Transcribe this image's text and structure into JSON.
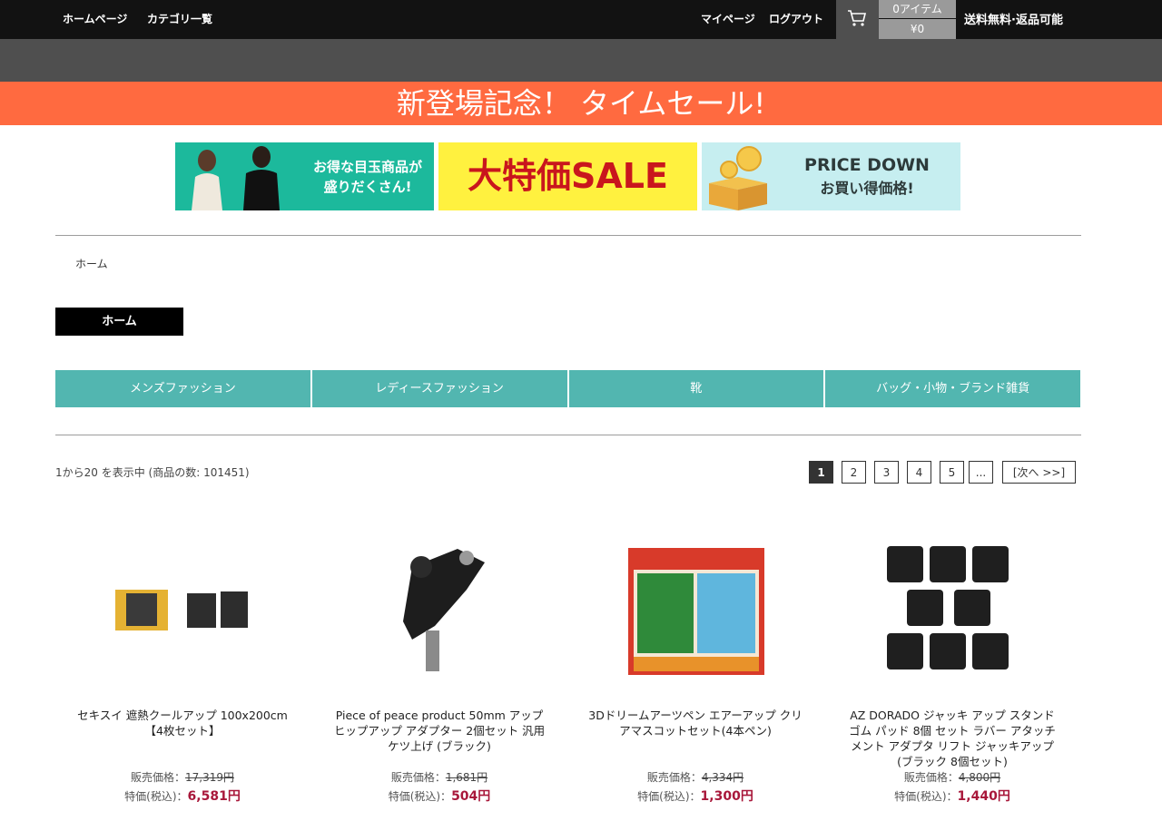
{
  "header": {
    "nav_home": "ホームページ",
    "nav_categories": "カテゴリ一覧",
    "mypage": "マイページ",
    "logout": "ログアウト",
    "cart_icon": "cart-icon",
    "cart_items": "0アイテム",
    "cart_total": "¥0",
    "shipping": "送料無料·返品可能"
  },
  "sale_banner": "新登場記念！ タイムセール!",
  "banners": [
    {
      "line1": "お得な目玉商品が",
      "line2": "盛りだくさん!",
      "bg": "#1cb99c"
    },
    {
      "text": "大特価SALE",
      "bg": "#fff13f",
      "text_color": "#c9161d"
    },
    {
      "line1": "PRICE DOWN",
      "line2": "お買い得価格!",
      "bg": "#c6eef0"
    }
  ],
  "breadcrumb": "ホーム",
  "page_title": "ホーム",
  "categories": [
    "メンズファッション",
    "レディースファッション",
    "靴",
    "バッグ・小物・ブランド雑貨"
  ],
  "results_text": "1から20 を表示中 (商品の数: 101451)",
  "pagination": [
    "1",
    "2",
    "3",
    "4",
    "5",
    "...",
    "[次へ >>]"
  ],
  "products": [
    {
      "name": "セキスイ 遮熱クールアップ 100x200cm【4枚セット】",
      "list_label": "販売価格：",
      "list_price": "17,319円",
      "sale_label": "特価(税込)：",
      "sale_price": "6,581円"
    },
    {
      "name": "Piece of peace product 50mm アップ ヒップアップ アダプター 2個セット 汎用 ケツ上げ (ブラック)",
      "list_label": "販売価格：",
      "list_price": "1,681円",
      "sale_label": "特価(税込)：",
      "sale_price": "504円"
    },
    {
      "name": "3Dドリームアーツペン エアーアップ クリアマスコットセット(4本ペン)",
      "list_label": "販売価格：",
      "list_price": "4,334円",
      "sale_label": "特価(税込)：",
      "sale_price": "1,300円"
    },
    {
      "name": "AZ DORADO ジャッキ アップ スタンド ゴム パッド 8個 セット ラバー アタッチメント アダプタ リフト ジャッキアップ (ブラック 8個セット)",
      "list_label": "販売価格：",
      "list_price": "4,800円",
      "sale_label": "特価(税込)：",
      "sale_price": "1,440円"
    }
  ],
  "colors": {
    "sale_bar": "#ff6a40",
    "category_bg": "#52b6b0",
    "price": "#a8173a"
  }
}
